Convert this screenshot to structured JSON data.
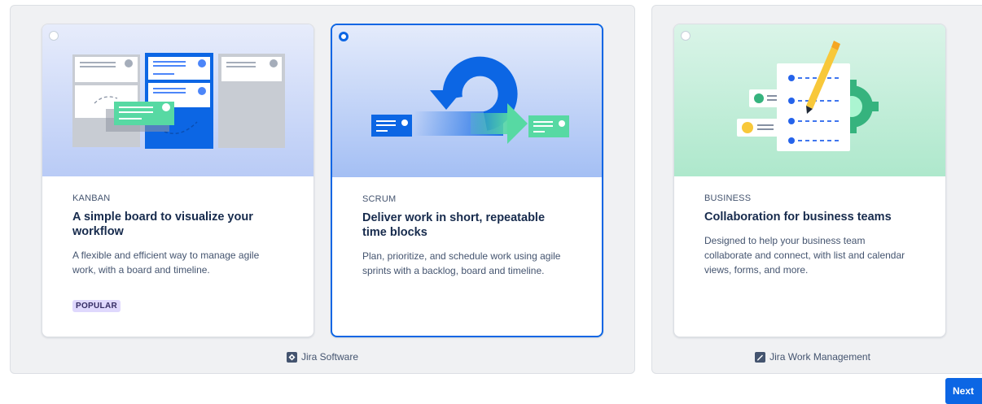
{
  "groups": [
    {
      "name": "Jira Software",
      "icon": "jira-software-icon"
    },
    {
      "name": "Jira Work Management",
      "icon": "jira-work-management-icon"
    }
  ],
  "templates": [
    {
      "eyebrow": "KANBAN",
      "title": "A simple board to visualize your workflow",
      "description": "A flexible and efficient way to manage agile work, with a board and timeline.",
      "badge": "POPULAR",
      "selected": false,
      "illustration": "kanban-board-illustration"
    },
    {
      "eyebrow": "SCRUM",
      "title": "Deliver work in short, repeatable time blocks",
      "description": "Plan, prioritize, and schedule work using agile sprints with a backlog, board and timeline.",
      "selected": true,
      "illustration": "scrum-sprint-cycle-illustration"
    },
    {
      "eyebrow": "BUSINESS",
      "title": "Collaboration for business teams",
      "description": "Designed to help your business team collaborate and connect, with list and calendar views, forms, and more.",
      "selected": false,
      "illustration": "business-checklist-illustration"
    }
  ],
  "footer": {
    "next_label": "Next"
  },
  "colors": {
    "primary": "#0c66e4",
    "badge_bg": "#dfd8fd",
    "group_bg": "#f0f1f3"
  }
}
